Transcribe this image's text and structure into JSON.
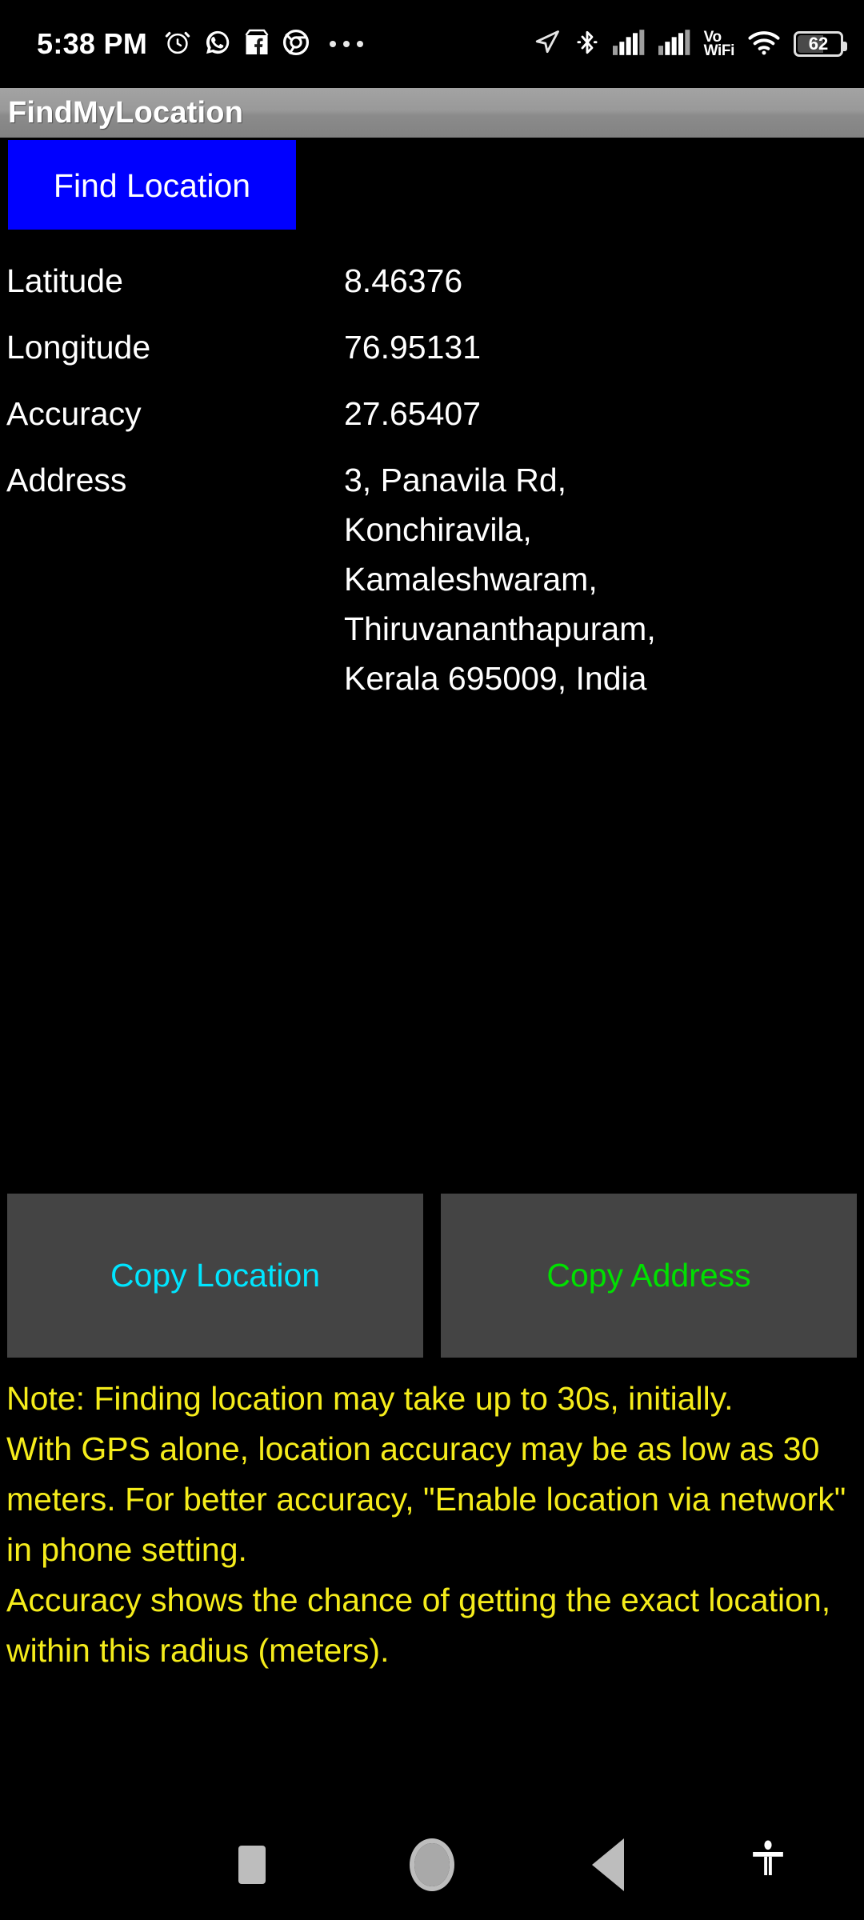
{
  "status_bar": {
    "time": "5:38 PM",
    "left_icons": [
      "alarm-clock-icon",
      "whatsapp-icon",
      "facebook-marketplace-icon",
      "chrome-icon",
      "more-notifications-icon"
    ],
    "right_icons": [
      "location-arrow-icon",
      "bluetooth-icon",
      "signal-sim1-icon",
      "signal-sim2-icon",
      "vowifi-icon",
      "wifi-icon",
      "battery-icon"
    ],
    "vowifi_top": "Vo",
    "vowifi_bottom": "WiFi",
    "battery_percent": "62"
  },
  "app": {
    "title": "FindMyLocation"
  },
  "actions": {
    "find_location_label": "Find Location",
    "copy_location_label": "Copy Location",
    "copy_address_label": "Copy Address"
  },
  "info": {
    "rows": [
      {
        "label": "Latitude",
        "value": "8.46376"
      },
      {
        "label": "Longitude",
        "value": "76.95131"
      },
      {
        "label": "Accuracy",
        "value": "27.65407"
      },
      {
        "label": "Address",
        "value": "3, Panavila Rd,\nKonchiravila,\nKamaleshwaram,\nThiruvananthapuram,\nKerala 695009, India"
      }
    ]
  },
  "note": {
    "text": "Note: Finding location may take up to 30s, initially.\n With GPS alone, location accuracy may be as low as 30 meters. For better accuracy, \"Enable location via network\" in phone setting.\n Accuracy shows the chance of getting the exact location, within this radius (meters)."
  },
  "nav_bar": {
    "items": [
      "recents-icon",
      "home-icon",
      "back-icon",
      "accessibility-icon"
    ]
  },
  "colors": {
    "background": "#000000",
    "title_bar": "#999999",
    "find_button": "#0000ff",
    "copy_button": "#444444",
    "copy_location_text": "#00e5ff",
    "copy_address_text": "#00e000",
    "note_text": "#f5ec1b"
  }
}
